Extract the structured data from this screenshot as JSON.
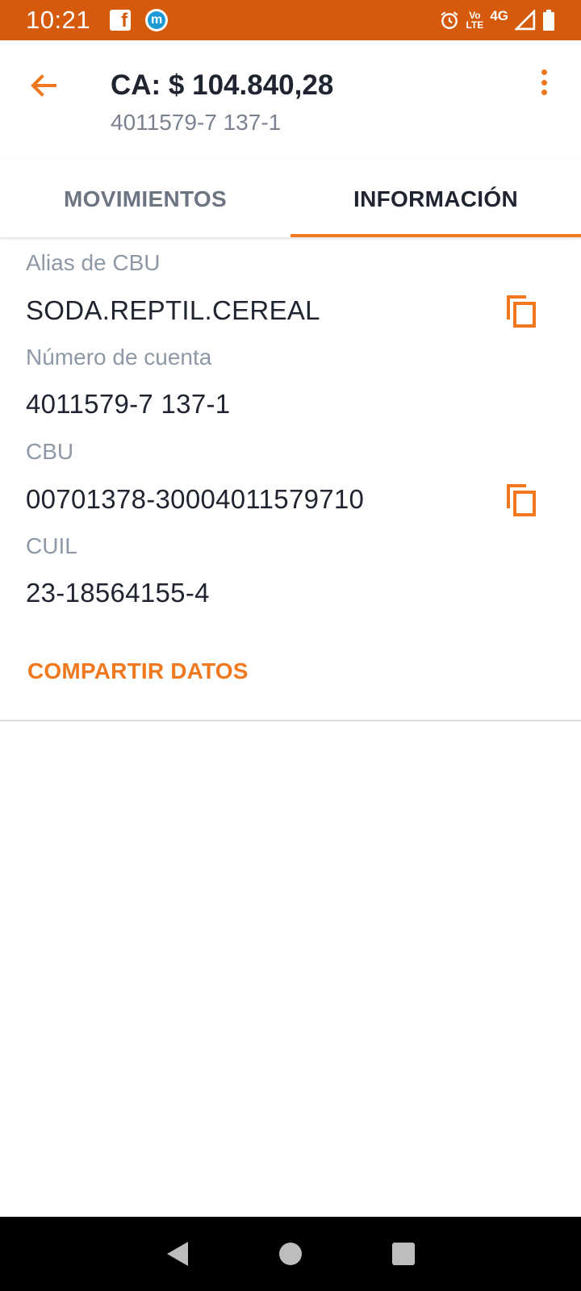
{
  "status_bar": {
    "time": "10:21",
    "left_icons": [
      "facebook-icon",
      "movistar-icon"
    ],
    "volte_top": "Vo",
    "volte_bottom": "LTE",
    "network": "4G",
    "color": "#d55a0b"
  },
  "header": {
    "title": "CA: $ 104.840,28",
    "subtitle": "4011579-7 137-1"
  },
  "tabs": [
    {
      "label": "MOVIMIENTOS",
      "active": false
    },
    {
      "label": "INFORMACIÓN",
      "active": true
    }
  ],
  "info": {
    "alias_label": "Alias de CBU",
    "alias_value": "SODA.REPTIL.CEREAL",
    "account_label": "Número de cuenta",
    "account_value": "4011579-7 137-1",
    "cbu_label": "CBU",
    "cbu_value": "00701378-30004011579710",
    "cuil_label": "CUIL",
    "cuil_value": "23-18564155-4",
    "share_label": "COMPARTIR DATOS"
  },
  "colors": {
    "accent": "#f0781e",
    "text_primary": "#1f2430",
    "text_secondary": "#8e98a6"
  }
}
